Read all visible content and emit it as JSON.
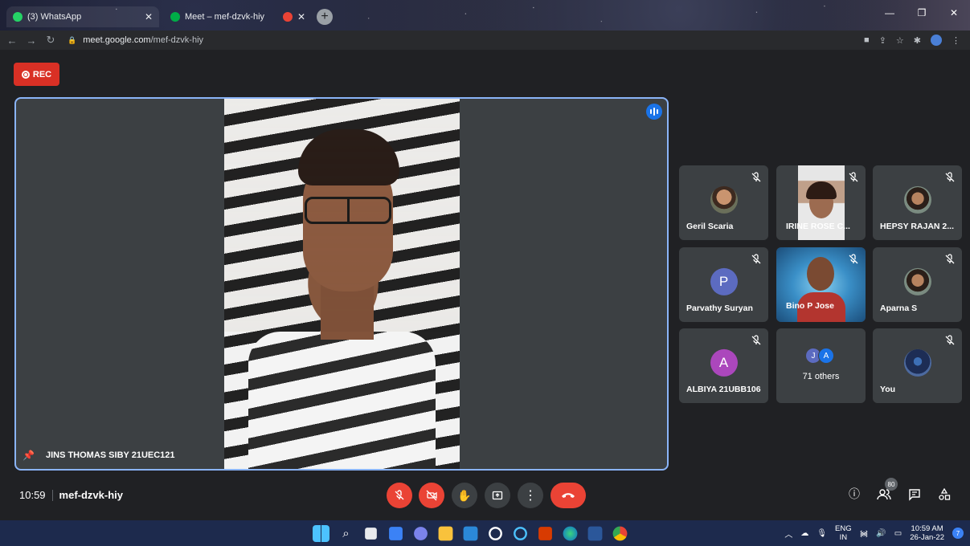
{
  "browser": {
    "tabs": [
      {
        "title": "(3) WhatsApp",
        "favicon_color": "#25d366"
      },
      {
        "title": "Meet – mef-dzvk-hiy",
        "favicon_color": "#00ac47"
      },
      {
        "title": "",
        "favicon_color": "#ea4335"
      }
    ],
    "new_tab": "+",
    "url_host": "meet.google.com",
    "url_path": "/mef-dzvk-hiy"
  },
  "meet": {
    "rec_label": "REC",
    "main_speaker": "JINS THOMAS SIBY 21UEC121",
    "tiles": [
      {
        "name": "Geril Scaria",
        "type": "photo"
      },
      {
        "name": "IRINE ROSE C...",
        "type": "video"
      },
      {
        "name": "HEPSY RAJAN 2...",
        "type": "photo"
      },
      {
        "name": "Parvathy Suryan",
        "type": "initial",
        "initial": "P",
        "color": "#5c6bc0"
      },
      {
        "name": "Bino P Jose",
        "type": "video"
      },
      {
        "name": "Aparna S",
        "type": "photo"
      },
      {
        "name": "ALBIYA 21UBB106",
        "type": "initial",
        "initial": "A",
        "color": "#ab47bc"
      },
      {
        "name": "71 others",
        "type": "others",
        "initials": [
          "J",
          "A"
        ]
      },
      {
        "name": "You",
        "type": "photo"
      }
    ],
    "time": "10:59",
    "meeting_code": "mef-dzvk-hiy",
    "participants_count": "80",
    "accent": "#8ab4f8",
    "danger": "#ea4335"
  },
  "taskbar": {
    "lang_top": "ENG",
    "lang_bottom": "IN",
    "time": "10:59 AM",
    "date": "26-Jan-22",
    "notifications": "7"
  }
}
